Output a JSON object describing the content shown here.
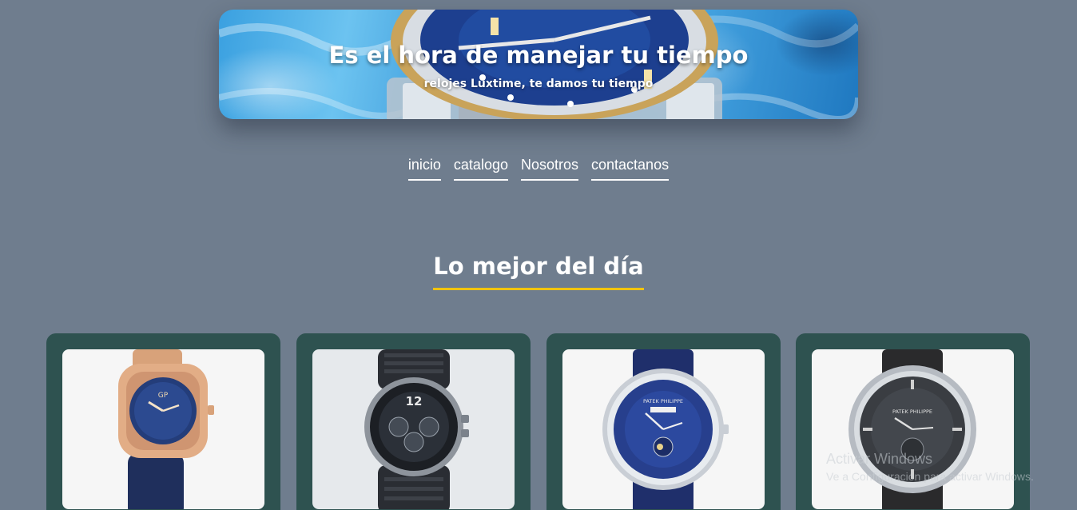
{
  "hero": {
    "title": "Es el hora de manejar tu tiempo",
    "subtitle": "relojes Luxtime, te damos tu tiempo"
  },
  "nav": {
    "items": [
      {
        "label": "inicio"
      },
      {
        "label": "catalogo"
      },
      {
        "label": "Nosotros"
      },
      {
        "label": "contactanos"
      }
    ]
  },
  "section": {
    "title": "Lo mejor del día",
    "underline_color": "#f1c40f"
  },
  "products": [
    {
      "image": "watch-rose-gold-blue-dial",
      "dial_brand": "GP"
    },
    {
      "image": "watch-black-chronograph-rubber-strap",
      "dial_brand": "12"
    },
    {
      "image": "watch-blue-dial-moonphase",
      "dial_brand": "PATEK PHILIPPE"
    },
    {
      "image": "watch-grey-dial-steel",
      "dial_brand": "PATEK PHILIPPE"
    }
  ],
  "watermark": {
    "title": "Activar Windows",
    "subtitle": "Ve a Configuración para activar Windows."
  },
  "colors": {
    "background": "#6f7d8e",
    "card": "#2e5250",
    "accent": "#f1c40f",
    "text": "#ffffff"
  }
}
